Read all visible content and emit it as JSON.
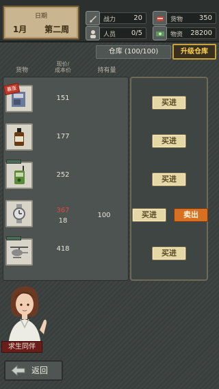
{
  "date": {
    "label": "日期",
    "month": "1月",
    "week": "第二周"
  },
  "stats": {
    "combat": {
      "label": "战力",
      "value": "20"
    },
    "people": {
      "label": "人员",
      "value": "0/5"
    },
    "goods": {
      "label": "货物",
      "value": "350"
    },
    "funds": {
      "label": "物资",
      "value": "28200"
    }
  },
  "warehouse": {
    "label": "仓库 (100/100)",
    "upgrade": "升级仓库"
  },
  "columns": {
    "goods": "货物",
    "price1": "现价/",
    "price2": "成本价",
    "holding": "持有量"
  },
  "items": [
    {
      "name": "书籍",
      "price": "151",
      "cost": "",
      "qty": "",
      "flag": "暴涨",
      "actions": [
        "买进"
      ]
    },
    {
      "name": "威士忌",
      "price": "177",
      "cost": "",
      "qty": "",
      "flag": "",
      "actions": [
        "买进"
      ]
    },
    {
      "name": "对讲机",
      "price": "252",
      "cost": "",
      "qty": "",
      "flag": "",
      "actions": [
        "买进"
      ]
    },
    {
      "name": "手表",
      "price": "367",
      "cost": "18",
      "qty": "100",
      "flag": "",
      "actions": [
        "买进",
        "卖出"
      ]
    },
    {
      "name": "直升机",
      "price": "418",
      "cost": "",
      "qty": "",
      "flag": "",
      "actions": [
        "买进"
      ]
    }
  ],
  "companion": "求生同伴",
  "back": "返回"
}
